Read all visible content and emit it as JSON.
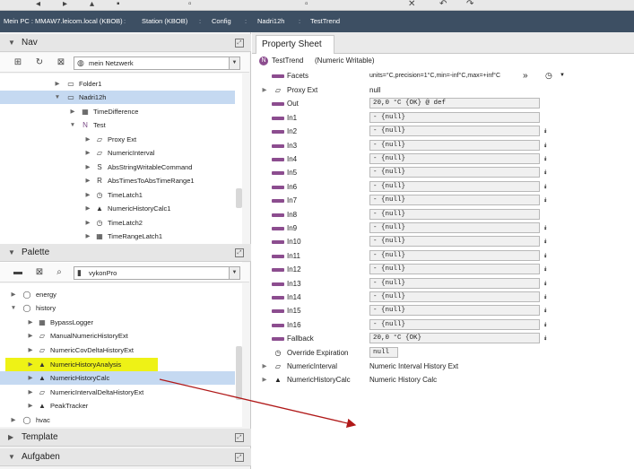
{
  "toolbar": {
    "icons": [
      "back-icon",
      "forward-icon",
      "up-icon",
      "save-icon",
      "copy-icon",
      "paste-icon",
      "delete-icon",
      "undo-icon",
      "redo-icon"
    ]
  },
  "breadcrumb": {
    "items": [
      "Mein PC : MMAW7.leicom.local (KBOB)",
      "Station (KBOB)",
      "Config",
      "Nadri12h",
      "TestTrend"
    ],
    "separator": ":"
  },
  "nav": {
    "title": "Nav",
    "network_label": "mein Netzwerk",
    "tree": [
      {
        "label": "Folder1",
        "icon": "folder-icon"
      },
      {
        "label": "Nadri12h",
        "icon": "folder-icon",
        "selected": true
      },
      {
        "label": "TimeDifference",
        "icon": "component-icon"
      },
      {
        "label": "Test",
        "icon": "numeric-icon",
        "glyph": "N"
      },
      {
        "label": "Proxy Ext",
        "icon": "proxy-icon"
      },
      {
        "label": "NumericInterval",
        "icon": "history-ext-icon"
      },
      {
        "label": "AbsStringWritableCommand",
        "icon": "string-icon",
        "glyph": "S"
      },
      {
        "label": "AbsTimesToAbsTimeRange1",
        "icon": "time-range-icon",
        "glyph": "R"
      },
      {
        "label": "TimeLatch1",
        "icon": "clock-icon"
      },
      {
        "label": "NumericHistoryCalc1",
        "icon": "triangle-icon"
      },
      {
        "label": "TimeLatch2",
        "icon": "clock-icon"
      },
      {
        "label": "TimeRangeLatch1",
        "icon": "component-icon"
      }
    ]
  },
  "palette": {
    "title": "Palette",
    "module_label": "vykonPro",
    "tree": [
      {
        "label": "energy",
        "icon": "module-icon"
      },
      {
        "label": "history",
        "icon": "module-icon"
      },
      {
        "label": "BypassLogger",
        "icon": "component-icon"
      },
      {
        "label": "ManualNumericHistoryExt",
        "icon": "history-ext-icon"
      },
      {
        "label": "NumericCovDeltaHistoryExt",
        "icon": "history-ext-icon"
      },
      {
        "label": "NumericHistoryAnalysis",
        "icon": "triangle-icon",
        "highlighted": true
      },
      {
        "label": "NumericHistoryCalc",
        "icon": "triangle-icon",
        "highlighted": true,
        "selected": true
      },
      {
        "label": "NumericIntervalDeltaHistoryExt",
        "icon": "history-ext-icon"
      },
      {
        "label": "PeakTracker",
        "icon": "triangle-icon"
      },
      {
        "label": "hvac",
        "icon": "module-icon"
      }
    ]
  },
  "template": {
    "title": "Template"
  },
  "aufgaben": {
    "title": "Aufgaben"
  },
  "property_sheet": {
    "tab_label": "Property Sheet",
    "header_name": "TestTrend",
    "header_type": "(Numeric Writable)",
    "facets_value": "units=°C,precision=1°C,min=-inf°C,max=+inf°C",
    "rows": [
      {
        "name": "Facets",
        "kind": "facets"
      },
      {
        "name": "Proxy Ext",
        "value": "null",
        "kind": "plain",
        "expandable": true
      },
      {
        "name": "Out",
        "value": "20,0 °C {OK} @ def",
        "kind": "slot"
      },
      {
        "name": "In1",
        "value": "- {null}",
        "kind": "slot"
      },
      {
        "name": "In2",
        "value": "- {null}",
        "kind": "slot",
        "action": true
      },
      {
        "name": "In3",
        "value": "- {null}",
        "kind": "slot",
        "action": true
      },
      {
        "name": "In4",
        "value": "- {null}",
        "kind": "slot",
        "action": true
      },
      {
        "name": "In5",
        "value": "- {null}",
        "kind": "slot",
        "action": true
      },
      {
        "name": "In6",
        "value": "- {null}",
        "kind": "slot",
        "action": true
      },
      {
        "name": "In7",
        "value": "- {null}",
        "kind": "slot",
        "action": true
      },
      {
        "name": "In8",
        "value": "- {null}",
        "kind": "slot"
      },
      {
        "name": "In9",
        "value": "- {null}",
        "kind": "slot",
        "action": true
      },
      {
        "name": "In10",
        "value": "- {null}",
        "kind": "slot",
        "action": true
      },
      {
        "name": "In11",
        "value": "- {null}",
        "kind": "slot",
        "action": true
      },
      {
        "name": "In12",
        "value": "- {null}",
        "kind": "slot",
        "action": true
      },
      {
        "name": "In13",
        "value": "- {null}",
        "kind": "slot",
        "action": true
      },
      {
        "name": "In14",
        "value": "- {null}",
        "kind": "slot",
        "action": true
      },
      {
        "name": "In15",
        "value": "- {null}",
        "kind": "slot",
        "action": true
      },
      {
        "name": "In16",
        "value": "- {null}",
        "kind": "slot",
        "action": true
      },
      {
        "name": "Fallback",
        "value": "20,0 °C {OK}",
        "kind": "slot",
        "action": true
      },
      {
        "name": "Override Expiration",
        "value": "null",
        "kind": "clock"
      },
      {
        "name": "NumericInterval",
        "value": "Numeric Interval History Ext",
        "kind": "ext",
        "expandable": true
      },
      {
        "name": "NumericHistoryCalc",
        "value": "Numeric History Calc",
        "kind": "tri",
        "expandable": true
      }
    ]
  },
  "colors": {
    "breadcrumb_bg": "#3d4f63",
    "selection": "#c5d9f1",
    "highlight": "#f3f328",
    "slot_bar": "#8c4d8f",
    "annotation_arrow": "#b01818"
  }
}
